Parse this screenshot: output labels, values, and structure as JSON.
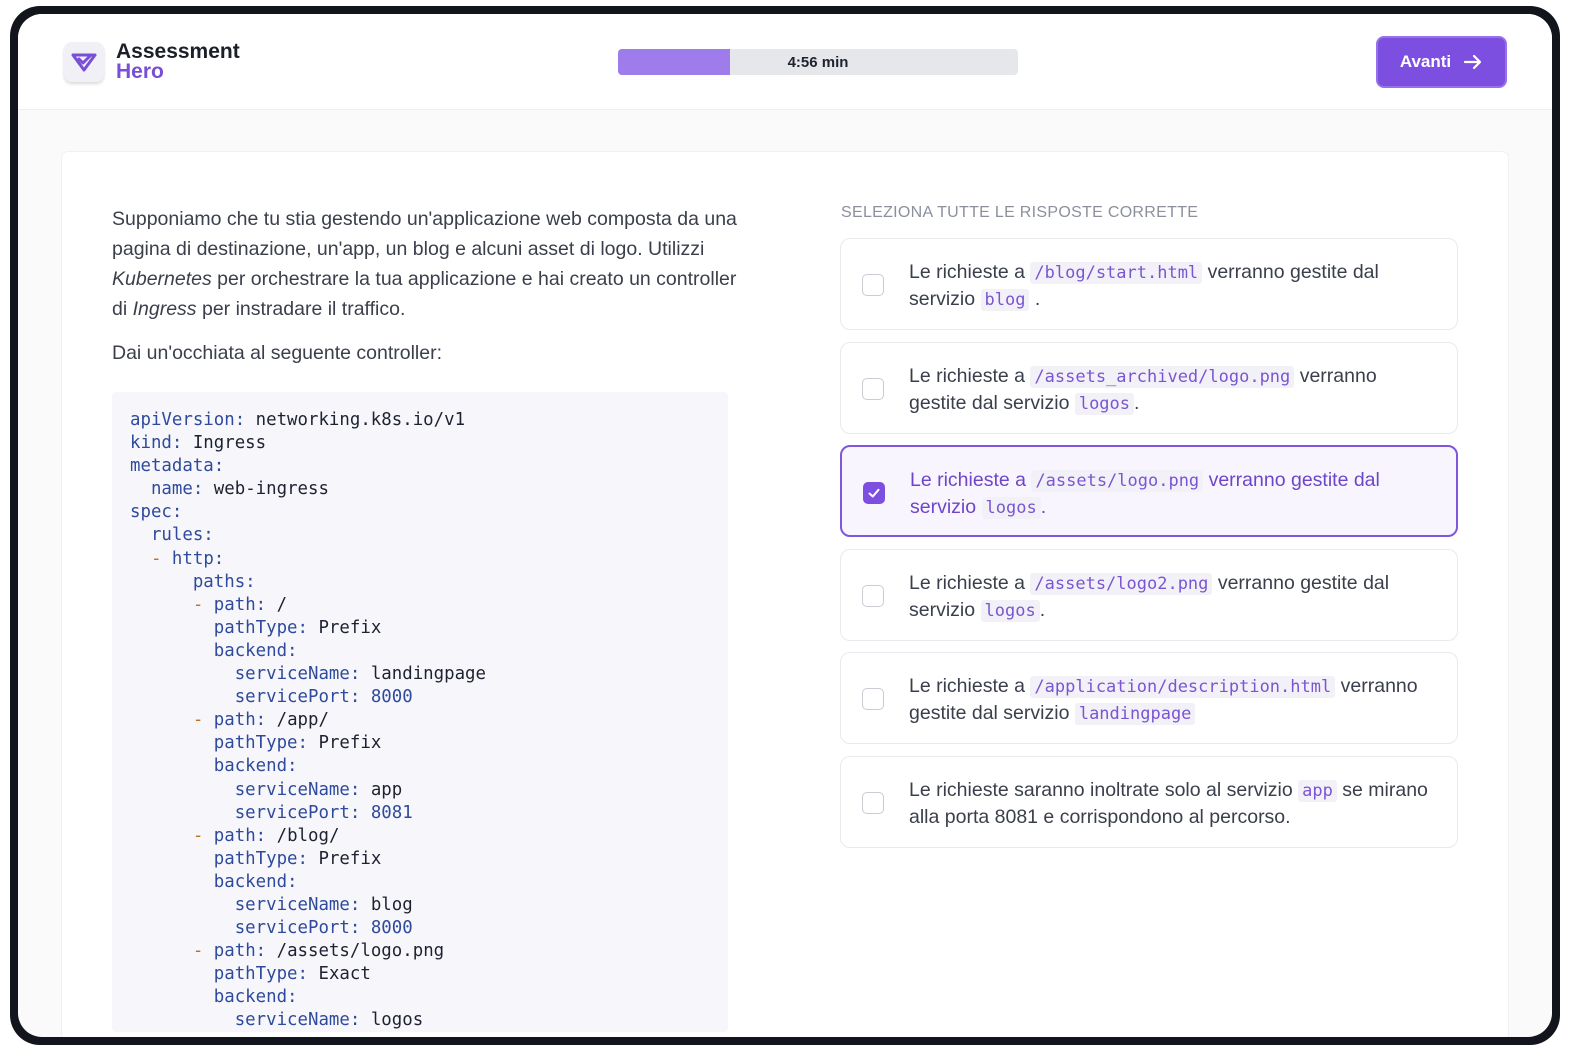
{
  "brand": {
    "line1": "Assessment",
    "line2": "Hero"
  },
  "timer": {
    "label": "4:56 min",
    "progress": 0.28
  },
  "next_button": {
    "label": "Avanti"
  },
  "question": {
    "p1": "Supponiamo che tu stia gestendo un'applicazione web composta da una pagina di destinazione, un'app, un blog e alcuni asset di logo. Utilizzi ",
    "em1": "Kubernetes",
    "p2": " per orchestrare la tua applicazione e hai creato un controller di ",
    "em2": "Ingress",
    "p3": " per instradare il traffico.",
    "prompt": "Dai un'occhiata al seguente controller:"
  },
  "code_lines": [
    {
      "indent": "",
      "dash": "",
      "key": "apiVersion",
      "value": " networking.k8s.io/v1"
    },
    {
      "indent": "",
      "dash": "",
      "key": "kind",
      "value": " Ingress"
    },
    {
      "indent": "",
      "dash": "",
      "key": "metadata",
      "value": ""
    },
    {
      "indent": "  ",
      "dash": "",
      "key": "name",
      "value": " web-ingress"
    },
    {
      "indent": "",
      "dash": "",
      "key": "spec",
      "value": ""
    },
    {
      "indent": "  ",
      "dash": "",
      "key": "rules",
      "value": ""
    },
    {
      "indent": "  ",
      "dash": "- ",
      "key": "http",
      "value": ""
    },
    {
      "indent": "      ",
      "dash": "",
      "key": "paths",
      "value": ""
    },
    {
      "indent": "      ",
      "dash": "- ",
      "key": "path",
      "value": " /"
    },
    {
      "indent": "        ",
      "dash": "",
      "key": "pathType",
      "value": " Prefix"
    },
    {
      "indent": "        ",
      "dash": "",
      "key": "backend",
      "value": ""
    },
    {
      "indent": "          ",
      "dash": "",
      "key": "serviceName",
      "value": " landingpage"
    },
    {
      "indent": "          ",
      "dash": "",
      "key": "servicePort",
      "value": " 8000",
      "num": true
    },
    {
      "indent": "      ",
      "dash": "- ",
      "key": "path",
      "value": " /app/"
    },
    {
      "indent": "        ",
      "dash": "",
      "key": "pathType",
      "value": " Prefix"
    },
    {
      "indent": "        ",
      "dash": "",
      "key": "backend",
      "value": ""
    },
    {
      "indent": "          ",
      "dash": "",
      "key": "serviceName",
      "value": " app"
    },
    {
      "indent": "          ",
      "dash": "",
      "key": "servicePort",
      "value": " 8081",
      "num": true
    },
    {
      "indent": "      ",
      "dash": "- ",
      "key": "path",
      "value": " /blog/"
    },
    {
      "indent": "        ",
      "dash": "",
      "key": "pathType",
      "value": " Prefix"
    },
    {
      "indent": "        ",
      "dash": "",
      "key": "backend",
      "value": ""
    },
    {
      "indent": "          ",
      "dash": "",
      "key": "serviceName",
      "value": " blog"
    },
    {
      "indent": "          ",
      "dash": "",
      "key": "servicePort",
      "value": " 8000",
      "num": true
    },
    {
      "indent": "      ",
      "dash": "- ",
      "key": "path",
      "value": " /assets/logo.png"
    },
    {
      "indent": "        ",
      "dash": "",
      "key": "pathType",
      "value": " Exact"
    },
    {
      "indent": "        ",
      "dash": "",
      "key": "backend",
      "value": ""
    },
    {
      "indent": "          ",
      "dash": "",
      "key": "serviceName",
      "value": " logos"
    }
  ],
  "instruction": "SELEZIONA TUTTE LE RISPOSTE CORRETTE",
  "options": [
    {
      "selected": false,
      "parts": [
        {
          "t": "Le richieste a "
        },
        {
          "c": "/blog/start.html"
        },
        {
          "t": " verranno gestite dal servizio "
        },
        {
          "c": "blog"
        },
        {
          "t": " ."
        }
      ]
    },
    {
      "selected": false,
      "parts": [
        {
          "t": "Le richieste a "
        },
        {
          "c": "/assets_archived/logo.png"
        },
        {
          "t": " verranno gestite dal servizio "
        },
        {
          "c": "logos"
        },
        {
          "t": "."
        }
      ]
    },
    {
      "selected": true,
      "parts": [
        {
          "t": "Le richieste a "
        },
        {
          "c": "/assets/logo.png"
        },
        {
          "t": " verranno gestite dal servizio "
        },
        {
          "c": "logos"
        },
        {
          "t": "."
        }
      ]
    },
    {
      "selected": false,
      "parts": [
        {
          "t": "Le richieste a "
        },
        {
          "c": "/assets/logo2.png"
        },
        {
          "t": " verranno gestite dal servizio "
        },
        {
          "c": "logos"
        },
        {
          "t": "."
        }
      ]
    },
    {
      "selected": false,
      "parts": [
        {
          "t": "Le richieste a "
        },
        {
          "c": "/application/description.html"
        },
        {
          "t": " verranno gestite dal servizio "
        },
        {
          "c": "landingpage"
        }
      ]
    },
    {
      "selected": false,
      "parts": [
        {
          "t": "Le richieste saranno inoltrate solo al servizio "
        },
        {
          "c": "app"
        },
        {
          "t": " se mirano alla porta 8081 e corrispondono al percorso."
        }
      ]
    }
  ],
  "colors": {
    "accent": "#7c4fe0",
    "progress_fill": "#9f7cec"
  }
}
